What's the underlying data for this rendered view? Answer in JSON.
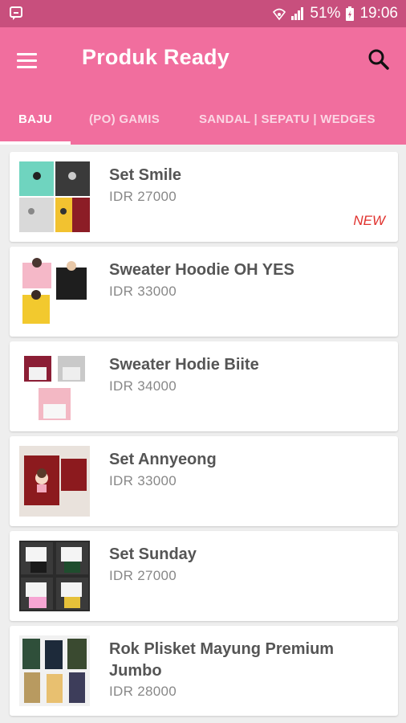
{
  "statusbar": {
    "battery": "51%",
    "time": "19:06"
  },
  "appbar": {
    "title": "Produk Ready"
  },
  "tabs": [
    {
      "label": "BAJU",
      "active": true
    },
    {
      "label": "(PO) GAMIS",
      "active": false
    },
    {
      "label": "SANDAL | SEPATU | WEDGES",
      "active": false
    }
  ],
  "products": [
    {
      "name": "Set Smile",
      "price": "IDR 27000",
      "badge": "NEW"
    },
    {
      "name": "Sweater Hoodie OH YES",
      "price": "IDR 33000"
    },
    {
      "name": "Sweater Hodie Biite",
      "price": "IDR 34000"
    },
    {
      "name": "Set Annyeong",
      "price": "IDR 33000"
    },
    {
      "name": "Set Sunday",
      "price": "IDR 27000"
    },
    {
      "name": "Rok Plisket Mayung Premium Jumbo",
      "price": "IDR 28000"
    }
  ],
  "colors": {
    "statusbar": "#c84f7d",
    "primary": "#f16e9e",
    "badge": "#e0312d"
  }
}
